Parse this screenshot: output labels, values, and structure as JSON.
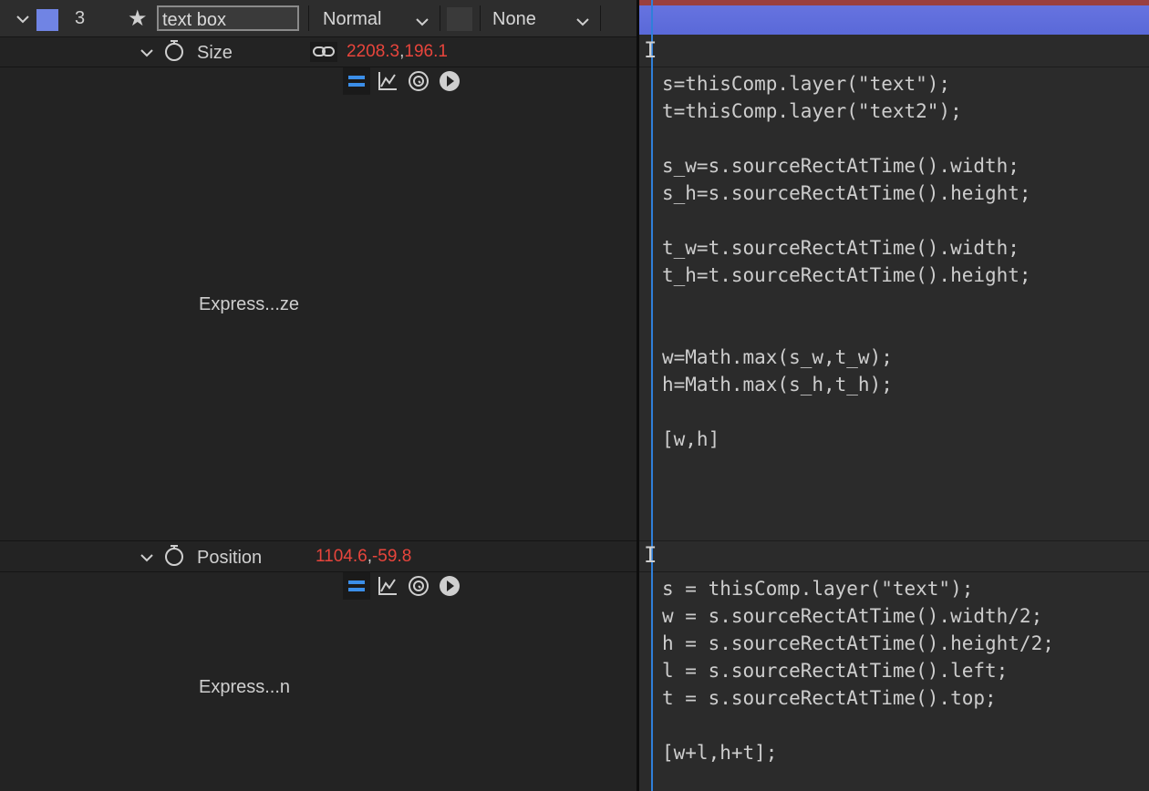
{
  "layer": {
    "number": "3",
    "name": "text box",
    "mode": "Normal",
    "track_matte": "None",
    "label_color": "#7084e4"
  },
  "properties": [
    {
      "name": "Size",
      "value_a": "2208.3",
      "value_b": "196.1",
      "expression_label": "Express...ze",
      "code": "s=thisComp.layer(\"text\");\nt=thisComp.layer(\"text2\");\n\ns_w=s.sourceRectAtTime().width;\ns_h=s.sourceRectAtTime().height;\n\nt_w=t.sourceRectAtTime().width;\nt_h=t.sourceRectAtTime().height;\n\n\nw=Math.max(s_w,t_w);\nh=Math.max(s_h,t_h);\n\n[w,h]"
    },
    {
      "name": "Position",
      "value_a": "1104.6",
      "value_b": "-59.8",
      "expression_label": "Express...n",
      "code": "s = thisComp.layer(\"text\");\nw = s.sourceRectAtTime().width/2;\nh = s.sourceRectAtTime().height/2;\nl = s.sourceRectAtTime().left;\nt = s.sourceRectAtTime().top;\n\n[w+l,h+t];"
    }
  ],
  "colors": {
    "value_red": "#e8453c",
    "expression_blue": "#3b8ee8",
    "cti_blue": "#2f7fd9",
    "layer_bar": "#6070dc"
  },
  "icons": [
    "chevron-down-icon",
    "star-icon",
    "stopwatch-icon",
    "link-icon",
    "expression-enable-icon",
    "graph-icon",
    "pickwhip-icon",
    "language-menu-icon"
  ]
}
